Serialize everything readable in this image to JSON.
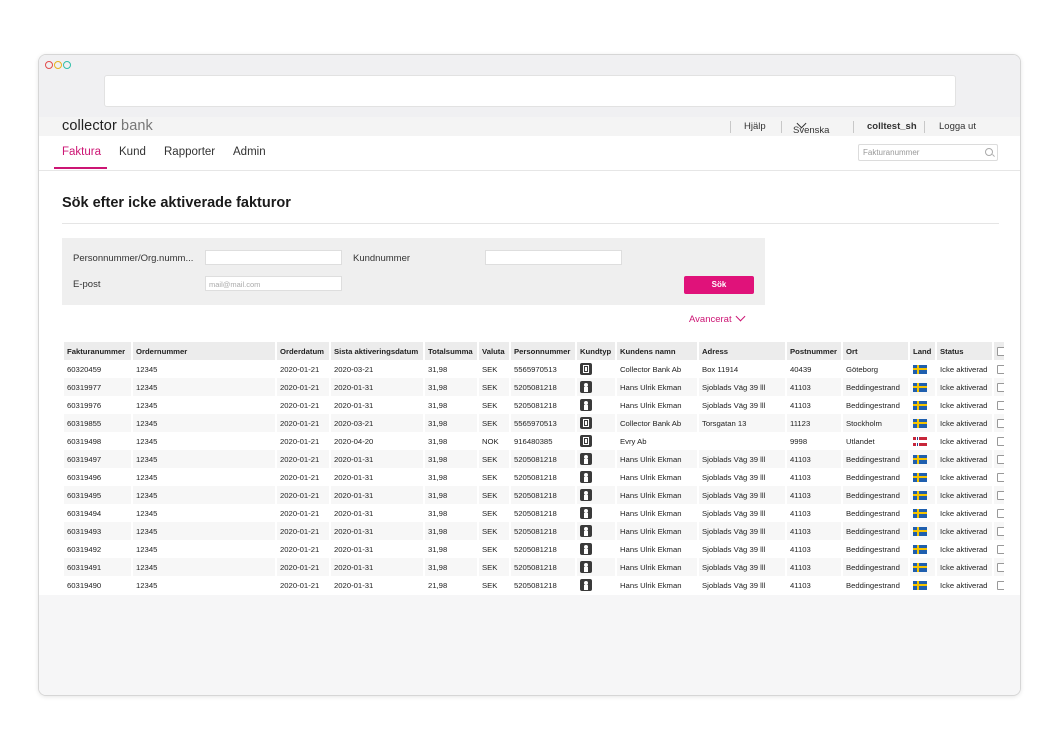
{
  "brand": {
    "name": "collector",
    "suffix": "bank"
  },
  "topbar": {
    "help": "Hjälp",
    "language": "Svenska",
    "user": "colltest_sh",
    "logout": "Logga ut"
  },
  "nav": {
    "tabs": [
      {
        "label": "Faktura",
        "active": true
      },
      {
        "label": "Kund",
        "active": false
      },
      {
        "label": "Rapporter",
        "active": false
      },
      {
        "label": "Admin",
        "active": false
      }
    ],
    "search_placeholder": "Fakturanummer"
  },
  "page": {
    "title": "Sök efter icke aktiverade fakturor"
  },
  "filter": {
    "personnummer_label": "Personnummer/Org.numm...",
    "kundnummer_label": "Kundnummer",
    "epost_label": "E-post",
    "epost_placeholder": "mail@mail.com",
    "search_button": "Sök",
    "advanced_link": "Avancerat"
  },
  "table": {
    "columns": [
      "Fakturanummer",
      "Ordernummer",
      "Orderdatum",
      "Sista aktiveringsdatum",
      "Totalsumma",
      "Valuta",
      "Personnummer",
      "Kundtyp",
      "Kundens namn",
      "Adress",
      "Postnummer",
      "Ort",
      "Land",
      "Status"
    ],
    "rows": [
      [
        "60320459",
        "12345",
        "2020-01-21",
        "2020-03-21",
        "31,98",
        "SEK",
        "5565970513",
        "company",
        "Collector Bank Ab",
        "Box 11914",
        "40439",
        "Göteborg",
        "se",
        "Icke aktiverad"
      ],
      [
        "60319977",
        "12345",
        "2020-01-21",
        "2020-01-31",
        "31,98",
        "SEK",
        "5205081218",
        "person",
        "Hans Ulrik Ekman",
        "Sjoblads Väg 39 lll",
        "41103",
        "Beddingestrand",
        "se",
        "Icke aktiverad"
      ],
      [
        "60319976",
        "12345",
        "2020-01-21",
        "2020-01-31",
        "31,98",
        "SEK",
        "5205081218",
        "person",
        "Hans Ulrik Ekman",
        "Sjoblads Väg 39 lll",
        "41103",
        "Beddingestrand",
        "se",
        "Icke aktiverad"
      ],
      [
        "60319855",
        "12345",
        "2020-01-21",
        "2020-03-21",
        "31,98",
        "SEK",
        "5565970513",
        "company",
        "Collector Bank Ab",
        "Torsgatan 13",
        "11123",
        "Stockholm",
        "se",
        "Icke aktiverad"
      ],
      [
        "60319498",
        "12345",
        "2020-01-21",
        "2020-04-20",
        "31,98",
        "NOK",
        "916480385",
        "company",
        "Evry Ab",
        "",
        "9998",
        "Utlandet",
        "no",
        "Icke aktiverad"
      ],
      [
        "60319497",
        "12345",
        "2020-01-21",
        "2020-01-31",
        "31,98",
        "SEK",
        "5205081218",
        "person",
        "Hans Ulrik Ekman",
        "Sjoblads Väg 39 lll",
        "41103",
        "Beddingestrand",
        "se",
        "Icke aktiverad"
      ],
      [
        "60319496",
        "12345",
        "2020-01-21",
        "2020-01-31",
        "31,98",
        "SEK",
        "5205081218",
        "person",
        "Hans Ulrik Ekman",
        "Sjoblads Väg 39 lll",
        "41103",
        "Beddingestrand",
        "se",
        "Icke aktiverad"
      ],
      [
        "60319495",
        "12345",
        "2020-01-21",
        "2020-01-31",
        "31,98",
        "SEK",
        "5205081218",
        "person",
        "Hans Ulrik Ekman",
        "Sjoblads Väg 39 lll",
        "41103",
        "Beddingestrand",
        "se",
        "Icke aktiverad"
      ],
      [
        "60319494",
        "12345",
        "2020-01-21",
        "2020-01-31",
        "31,98",
        "SEK",
        "5205081218",
        "person",
        "Hans Ulrik Ekman",
        "Sjoblads Väg 39 lll",
        "41103",
        "Beddingestrand",
        "se",
        "Icke aktiverad"
      ],
      [
        "60319493",
        "12345",
        "2020-01-21",
        "2020-01-31",
        "31,98",
        "SEK",
        "5205081218",
        "person",
        "Hans Ulrik Ekman",
        "Sjoblads Väg 39 lll",
        "41103",
        "Beddingestrand",
        "se",
        "Icke aktiverad"
      ],
      [
        "60319492",
        "12345",
        "2020-01-21",
        "2020-01-31",
        "31,98",
        "SEK",
        "5205081218",
        "person",
        "Hans Ulrik Ekman",
        "Sjoblads Väg 39 lll",
        "41103",
        "Beddingestrand",
        "se",
        "Icke aktiverad"
      ],
      [
        "60319491",
        "12345",
        "2020-01-21",
        "2020-01-31",
        "31,98",
        "SEK",
        "5205081218",
        "person",
        "Hans Ulrik Ekman",
        "Sjoblads Väg 39 lll",
        "41103",
        "Beddingestrand",
        "se",
        "Icke aktiverad"
      ],
      [
        "60319490",
        "12345",
        "2020-01-21",
        "2020-01-31",
        "21,98",
        "SEK",
        "5205081218",
        "person",
        "Hans Ulrik Ekman",
        "Sjoblads Väg 39 lll",
        "41103",
        "Beddingestrand",
        "se",
        "Icke aktiverad"
      ]
    ]
  },
  "colors": {
    "accent": "#e0127a",
    "nav_active": "#cc1574"
  }
}
